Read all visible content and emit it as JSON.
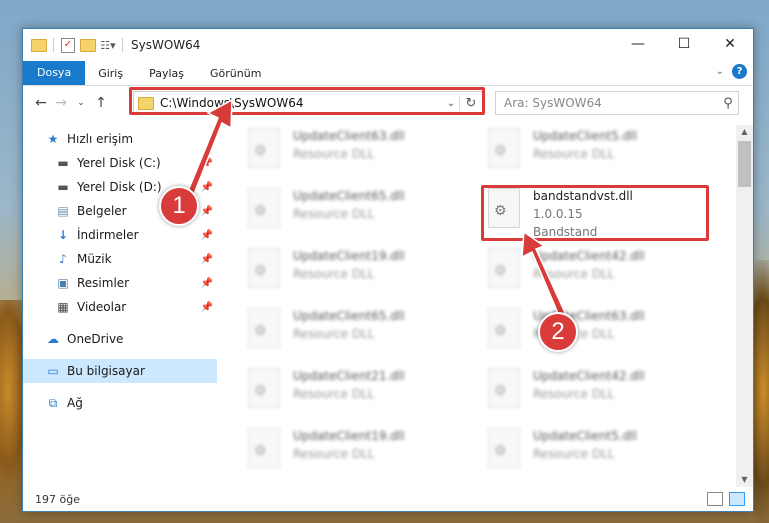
{
  "window": {
    "title": "SysWOW64",
    "controls": {
      "minimize": "—",
      "maximize": "☐",
      "close": "✕"
    }
  },
  "ribbon": {
    "tabs": [
      "Dosya",
      "Giriş",
      "Paylaş",
      "Görünüm"
    ],
    "help": "?"
  },
  "navigation": {
    "address": "C:\\Windows\\SysWOW64",
    "search_placeholder": "Ara: SysWOW64"
  },
  "sidebar": {
    "items": [
      {
        "label": "Hızlı erişim",
        "icon": "star-icon"
      },
      {
        "label": "Yerel Disk (C:)",
        "icon": "drive-icon",
        "pinned": true
      },
      {
        "label": "Yerel Disk (D:)",
        "icon": "drive-icon",
        "pinned": true
      },
      {
        "label": "Belgeler",
        "icon": "documents-icon",
        "pinned": true
      },
      {
        "label": "İndirmeler",
        "icon": "download-icon",
        "pinned": true
      },
      {
        "label": "Müzik",
        "icon": "music-icon",
        "pinned": true
      },
      {
        "label": "Resimler",
        "icon": "pictures-icon",
        "pinned": true
      },
      {
        "label": "Videolar",
        "icon": "videos-icon",
        "pinned": true
      },
      {
        "label": "OneDrive",
        "icon": "cloud-icon"
      },
      {
        "label": "Bu bilgisayar",
        "icon": "computer-icon",
        "selected": true
      },
      {
        "label": "Ağ",
        "icon": "network-icon"
      }
    ]
  },
  "files": [
    {
      "name": "UpdateClient63.dll",
      "desc": "Resource DLL",
      "blurred": true
    },
    {
      "name": "UpdateClient5.dll",
      "desc": "Resource DLL",
      "blurred": true
    },
    {
      "name": "UpdateClient65.dll",
      "desc": "Resource DLL",
      "blurred": true
    },
    {
      "name": "bandstandvst.dll",
      "version": "1.0.0.15",
      "desc": "Bandstand",
      "blurred": false
    },
    {
      "name": "UpdateClient19.dll",
      "desc": "Resource DLL",
      "blurred": true
    },
    {
      "name": "UpdateClient42.dll",
      "desc": "Resource DLL",
      "blurred": true
    },
    {
      "name": "UpdateClient65.dll",
      "desc": "Resource DLL",
      "blurred": true
    },
    {
      "name": "UpdateClient63.dll",
      "desc": "Resource DLL",
      "blurred": true
    },
    {
      "name": "UpdateClient21.dll",
      "desc": "Resource DLL",
      "blurred": true
    },
    {
      "name": "UpdateClient42.dll",
      "desc": "Resource DLL",
      "blurred": true
    },
    {
      "name": "UpdateClient19.dll",
      "desc": "Resource DLL",
      "blurred": true
    },
    {
      "name": "UpdateClient5.dll",
      "desc": "Resource DLL",
      "blurred": true
    }
  ],
  "status": {
    "count": "197 öğe"
  },
  "callouts": {
    "one": "1",
    "two": "2"
  },
  "colors": {
    "accent": "#1979ca",
    "highlight": "#d93a3a",
    "selection": "#cce8ff"
  }
}
